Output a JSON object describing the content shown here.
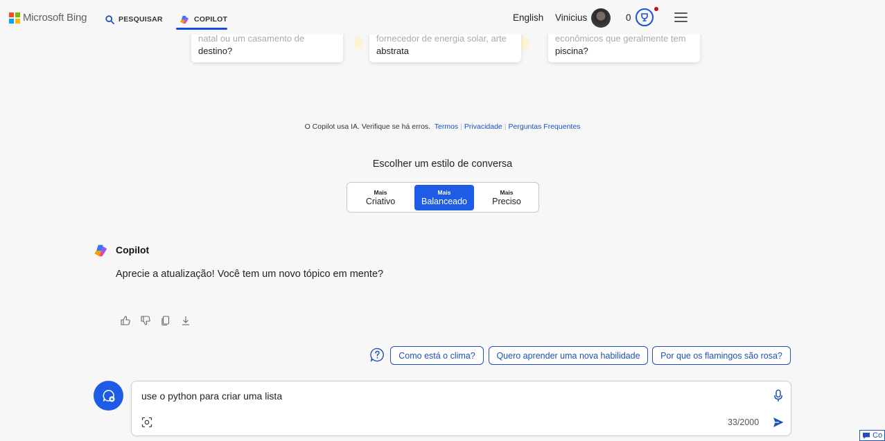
{
  "header": {
    "brand": "Microsoft Bing",
    "nav": {
      "search": "PESQUISAR",
      "copilot": "COPILOT"
    },
    "language": "English",
    "user_name": "Vinicius",
    "points": "0"
  },
  "cards": [
    {
      "faded": "natal ou um casamento de",
      "main": "destino?"
    },
    {
      "faded": "fornecedor de energia solar, arte",
      "main": "abstrata"
    },
    {
      "faded": "econômicos que geralmente tem",
      "main": "piscina?"
    }
  ],
  "disclaimer": {
    "text": "O Copilot usa IA. Verifique se há erros.",
    "links": [
      "Termos",
      "Privacidade",
      "Perguntas Frequentes"
    ]
  },
  "conversation_style": {
    "title": "Escolher um estilo de conversa",
    "options": [
      {
        "small": "Mais",
        "label": "Criativo",
        "active": false
      },
      {
        "small": "Mais",
        "label": "Balanceado",
        "active": true
      },
      {
        "small": "Mais",
        "label": "Preciso",
        "active": false
      }
    ]
  },
  "message": {
    "sender": "Copilot",
    "text": "Aprecie a atualização! Você tem um novo tópico em mente?"
  },
  "suggestions": [
    "Como está o clima?",
    "Quero aprender uma nova habilidade",
    "Por que os flamingos são rosa?"
  ],
  "input": {
    "value": "use o python para criar uma lista",
    "counter": "33/2000"
  },
  "feedback_label": "Co",
  "colors": {
    "accent": "#1f5ce6",
    "link": "#1a4fbd",
    "background": "#f7f7f7"
  },
  "icons": [
    "search-icon",
    "copilot-logo-icon",
    "trophy-icon",
    "menu-icon",
    "thumbs-up-icon",
    "thumbs-down-icon",
    "copy-icon",
    "download-icon",
    "help-icon",
    "new-topic-icon",
    "microphone-icon",
    "visual-search-icon",
    "send-icon",
    "feedback-icon"
  ]
}
